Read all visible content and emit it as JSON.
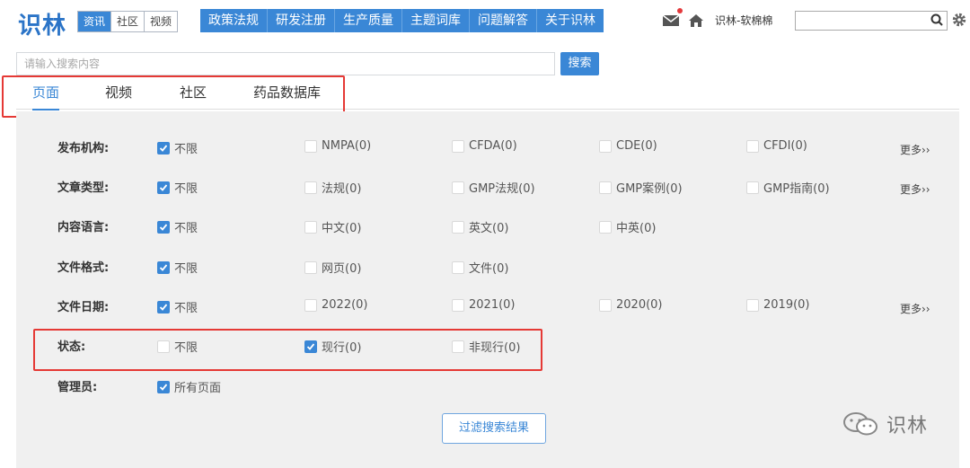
{
  "header": {
    "logo": "识林",
    "toggles": [
      "资讯",
      "社区",
      "视频"
    ],
    "nav": [
      "政策法规",
      "研发注册",
      "生产质量",
      "主题词库",
      "问题解答",
      "关于识林"
    ],
    "username": "识林-软棉棉",
    "icons": [
      "mail-icon",
      "home-icon",
      "search-icon",
      "gear-icon"
    ]
  },
  "search": {
    "placeholder": "请输入搜索内容",
    "button": "搜索"
  },
  "tabs": [
    "页面",
    "视频",
    "社区",
    "药品数据库"
  ],
  "filters": {
    "more_label": "更多››",
    "rows": [
      {
        "label": "发布机构:",
        "options": [
          "不限",
          "NMPA(0)",
          "CFDA(0)",
          "CDE(0)",
          "CFDI(0)"
        ],
        "checked": [
          true,
          false,
          false,
          false,
          false
        ],
        "more": true
      },
      {
        "label": "文章类型:",
        "options": [
          "不限",
          "法规(0)",
          "GMP法规(0)",
          "GMP案例(0)",
          "GMP指南(0)"
        ],
        "checked": [
          true,
          false,
          false,
          false,
          false
        ],
        "more": true
      },
      {
        "label": "内容语言:",
        "options": [
          "不限",
          "中文(0)",
          "英文(0)",
          "中英(0)"
        ],
        "checked": [
          true,
          false,
          false,
          false
        ],
        "more": false
      },
      {
        "label": "文件格式:",
        "options": [
          "不限",
          "网页(0)",
          "文件(0)"
        ],
        "checked": [
          true,
          false,
          false
        ],
        "more": false
      },
      {
        "label": "文件日期:",
        "options": [
          "不限",
          "2022(0)",
          "2021(0)",
          "2020(0)",
          "2019(0)"
        ],
        "checked": [
          true,
          false,
          false,
          false,
          false
        ],
        "more": true
      },
      {
        "label": "状态:",
        "options": [
          "不限",
          "现行(0)",
          "非现行(0)"
        ],
        "checked": [
          false,
          true,
          false
        ],
        "more": false
      },
      {
        "label": "管理员:",
        "options": [
          "所有页面"
        ],
        "checked": [
          true
        ],
        "more": false
      }
    ]
  },
  "filter_button": "过滤搜索结果",
  "watermark": "识林",
  "colors": {
    "accent": "#3a87d6",
    "highlight": "#e53935",
    "panel_bg": "#f0f0f0"
  }
}
